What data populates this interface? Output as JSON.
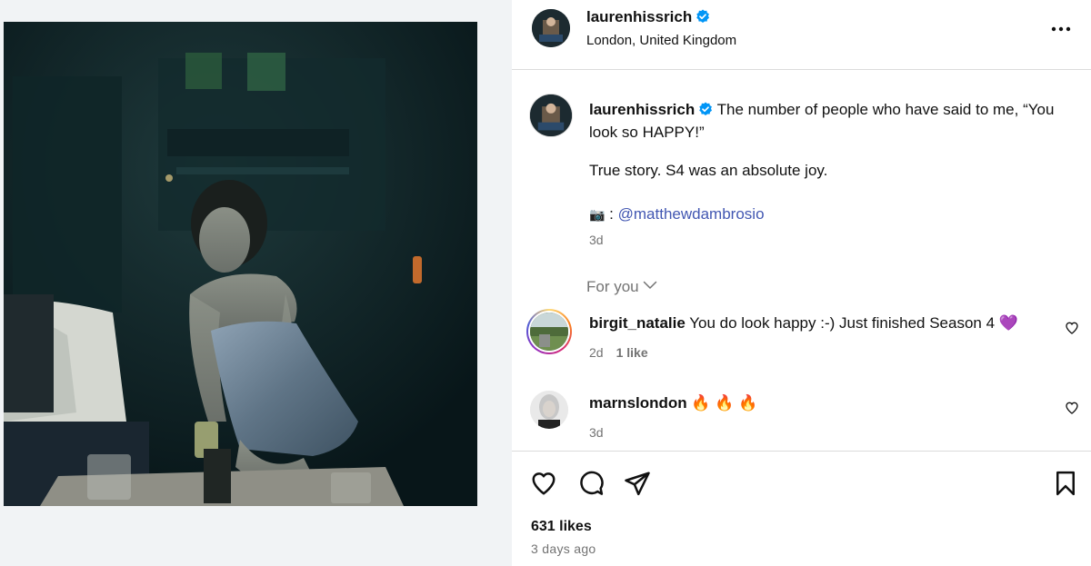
{
  "post": {
    "username": "laurenhissrich",
    "location": "London, United Kingdom",
    "caption_line1": "The number of people who have said to me, “You look so HAPPY!”",
    "caption_line2": "True story. S4 was an absolute joy.",
    "caption_camera": "📷",
    "caption_colon": ":",
    "caption_mention": "@matthewdambrosio",
    "caption_time": "3d",
    "likes": "631 likes",
    "posted_ago": "3 days ago"
  },
  "feed": {
    "for_you_label": "For you"
  },
  "comments": [
    {
      "username": "birgit_natalie",
      "text": "You do look happy :-) Just finished Season 4 💜",
      "time": "2d",
      "likes": "1 like"
    },
    {
      "username": "marnslondon",
      "text": "🔥 🔥 🔥",
      "time": "3d",
      "likes": ""
    }
  ],
  "icons": {
    "verified": "verified-badge-icon",
    "more": "more-options-icon",
    "like": "heart-icon",
    "comment": "comment-icon",
    "share": "share-icon",
    "save": "bookmark-icon"
  },
  "colors": {
    "verified_blue": "#0095f6",
    "mention": "#4257b2",
    "muted_text": "#737373"
  }
}
